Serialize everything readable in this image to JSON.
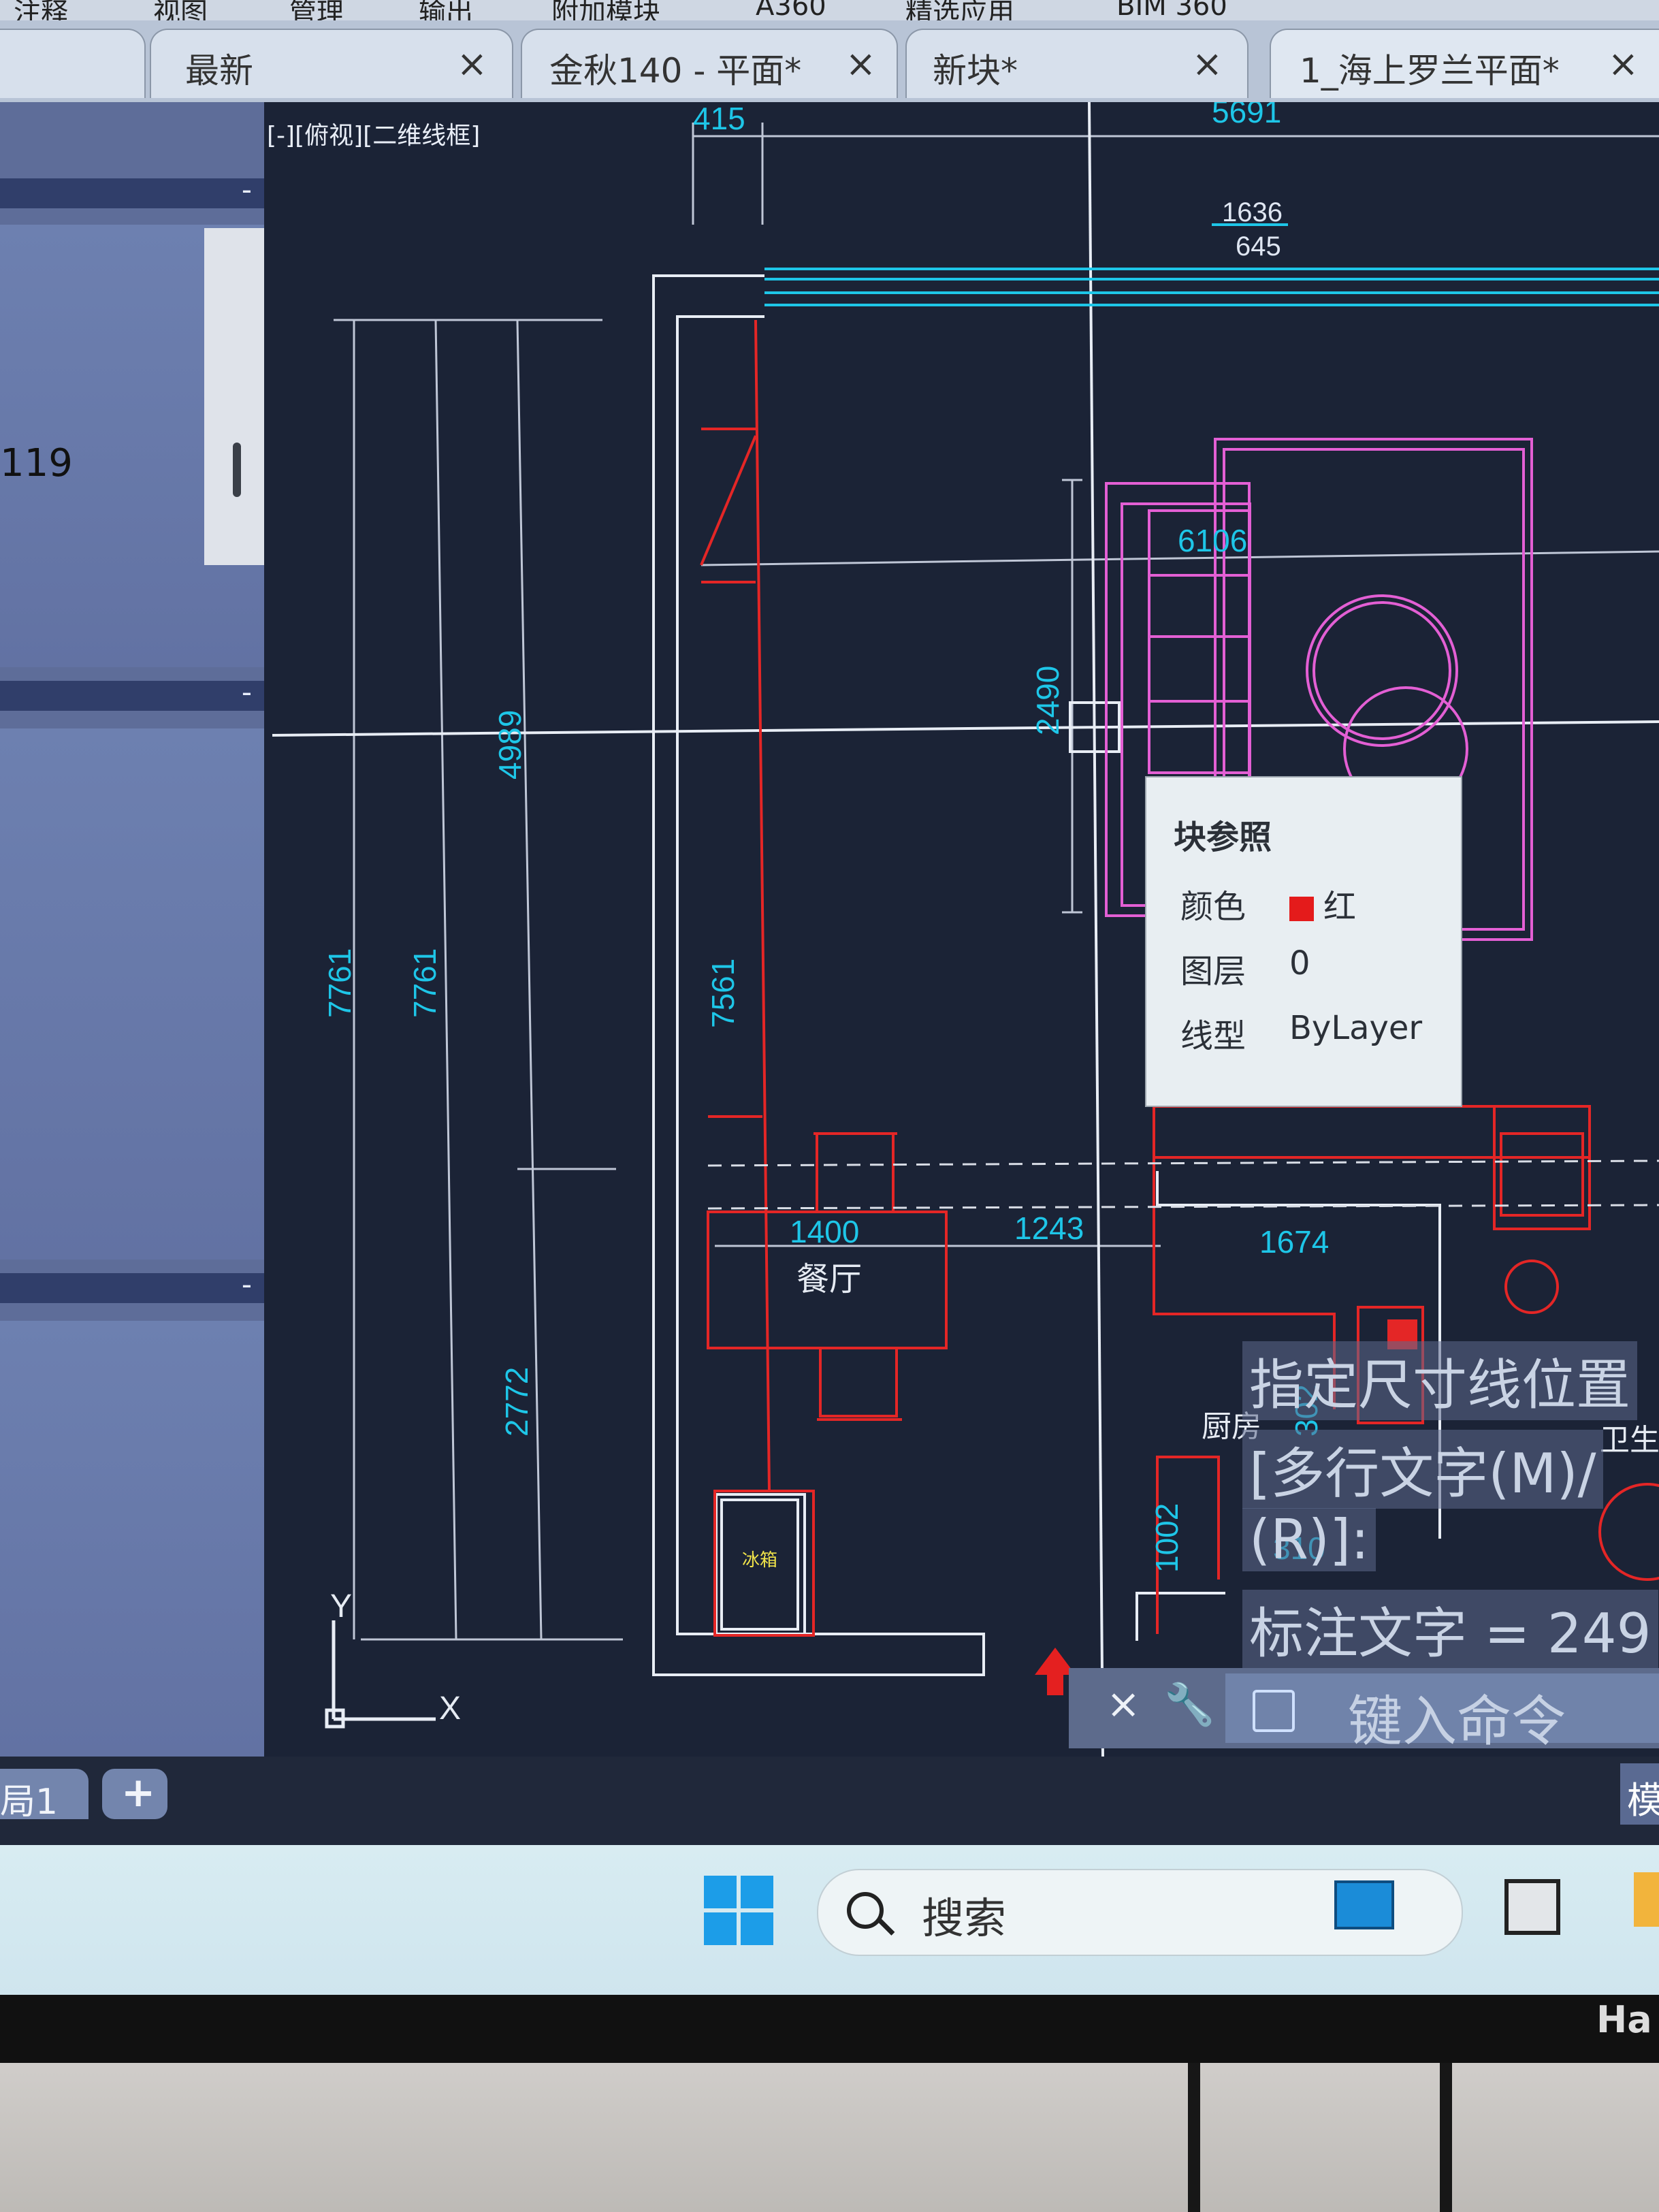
{
  "menu": [
    "注释",
    "视图",
    "管理",
    "输出",
    "附加模块",
    "A360",
    "精选应用",
    "BIM 360"
  ],
  "tabs": [
    {
      "label": "最新",
      "close": "×"
    },
    {
      "label": "金秋140 - 平面*",
      "close": "×"
    },
    {
      "label": "新块*",
      "close": "×"
    },
    {
      "label": "1_海上罗兰平面*",
      "close": "×"
    }
  ],
  "left_panel": {
    "value": "119",
    "minimize": "-"
  },
  "viewport": {
    "label": "[-][俯视][二维线框]"
  },
  "dimensions": {
    "d415": "415",
    "d5691": "5691",
    "d1636": "1636",
    "d645": "645",
    "d6106": "6106",
    "d2490": "2490",
    "d4989": "4989",
    "d7761a": "7761",
    "d7761b": "7761",
    "d7561": "7561",
    "d2772": "2772",
    "d1400": "1400",
    "d1243": "1243",
    "d1674": "1674",
    "d1002": "1002",
    "d302": "302",
    "d310": "310"
  },
  "rooms": {
    "dining": "餐厅",
    "kitchen": "厨房",
    "fridge": "冰箱",
    "bath": "卫生"
  },
  "ucs": {
    "y": "Y",
    "x": "X"
  },
  "tooltip": {
    "title": "块参照",
    "color_label": "颜色",
    "color_value": "红",
    "layer_label": "图层",
    "layer_value": "0",
    "linetype_label": "线型",
    "linetype_value": "ByLayer"
  },
  "prompts": [
    "指定尺寸线位置",
    "[多行文字(M)/",
    "(R)]:",
    "标注文字 = 249"
  ],
  "command": {
    "placeholder": "键入命令",
    "close": "×"
  },
  "status": {
    "layout": "局1",
    "add": "+",
    "model": "模"
  },
  "taskbar": {
    "search": "搜索"
  },
  "brand": "Ha"
}
